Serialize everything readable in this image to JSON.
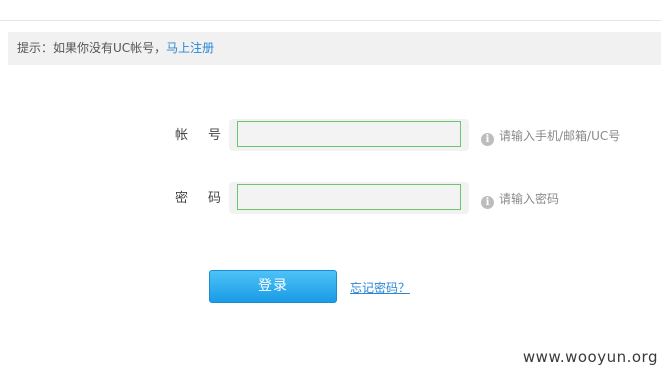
{
  "notice": {
    "text": "提示：如果你没有UC帐号，",
    "register_link": "马上注册"
  },
  "form": {
    "account": {
      "label": "帐号",
      "value": "",
      "hint": "请输入手机/邮箱/UC号",
      "hint_icon": "info-icon"
    },
    "password": {
      "label": "密码",
      "value": "",
      "hint": "请输入密码",
      "hint_icon": "info-icon"
    }
  },
  "actions": {
    "login_label": "登录",
    "forgot_label": "忘记密码？"
  },
  "watermark": "www.wooyun.org",
  "colors": {
    "link": "#2a87d5",
    "button_top": "#4dc2f7",
    "button_bottom": "#1a9be6",
    "input_border": "#6cc56c",
    "notice_bg": "#f1f1f1"
  }
}
